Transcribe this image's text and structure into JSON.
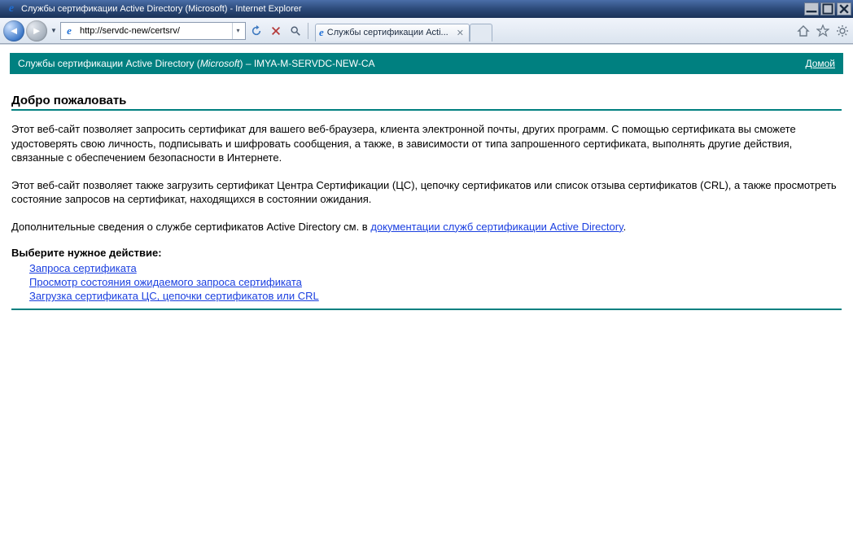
{
  "window": {
    "title": "Службы сертификации Active Directory (Microsoft) - Internet Explorer"
  },
  "toolbar": {
    "address_url": "http://servdc-new/certsrv/",
    "tab_title": "Службы сертификации Acti..."
  },
  "page": {
    "header_prefix": "Службы сертификации Active Directory (",
    "header_company": "Microsoft",
    "header_suffix": ")  –  IMYA-M-SERVDC-NEW-CA",
    "home_link": "Домой",
    "welcome": "Добро пожаловать",
    "para1": "Этот веб-сайт позволяет запросить сертификат для вашего веб-браузера, клиента электронной почты, других программ. С помощью сертификата вы сможете удостоверять свою личность, подписывать и шифровать сообщения, а также, в зависимости от типа запрошенного сертификата, выполнять другие действия, связанные с обеспечением безопасности в Интернете.",
    "para2": "Этот веб-сайт позволяет также загрузить сертификат Центра Сертификации (ЦС), цепочку сертификатов или список отзыва сертификатов (CRL), а также просмотреть состояние запросов на сертификат, находящихся в состоянии ожидания.",
    "para3_prefix": "Дополнительные сведения о службе сертификатов Active Directory см. в ",
    "para3_link": "документации служб сертификации Active Directory",
    "para3_suffix": ".",
    "action_head": "Выберите нужное действие:",
    "actions": [
      "Запроса сертификата",
      "Просмотр состояния ожидаемого запроса сертификата",
      "Загрузка сертификата ЦС, цепочки сертификатов или CRL"
    ]
  }
}
